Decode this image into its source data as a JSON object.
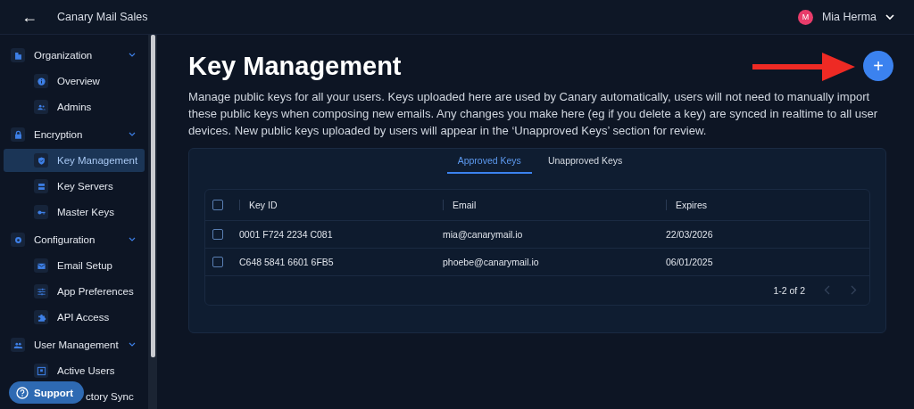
{
  "topbar": {
    "back": "←",
    "title": "Canary Mail Sales",
    "user": {
      "initial": "M",
      "name": "Mia Herma"
    }
  },
  "sidebar": {
    "groups": [
      {
        "label": "Organization",
        "expanded": true,
        "children": [
          {
            "label": "Overview",
            "selected": false
          },
          {
            "label": "Admins",
            "selected": false
          }
        ]
      },
      {
        "label": "Encryption",
        "expanded": true,
        "children": [
          {
            "label": "Key Management",
            "selected": true
          },
          {
            "label": "Key Servers",
            "selected": false
          },
          {
            "label": "Master Keys",
            "selected": false
          }
        ]
      },
      {
        "label": "Configuration",
        "expanded": true,
        "children": [
          {
            "label": "Email Setup",
            "selected": false
          },
          {
            "label": "App Preferences",
            "selected": false
          },
          {
            "label": "API Access",
            "selected": false
          }
        ]
      },
      {
        "label": "User Management",
        "expanded": true,
        "children": [
          {
            "label": "Active Users",
            "selected": false
          },
          {
            "label": "ctory Sync",
            "selected": false,
            "behind_support": true
          }
        ]
      }
    ]
  },
  "support": {
    "label": "Support"
  },
  "page": {
    "title": "Key Management",
    "description": "Manage public keys for all your users. Keys uploaded here are used by Canary automatically, users will not need to manually import these public keys when composing new emails. Any changes you make here (eg if you delete a key) are synced in realtime to all user devices. New public keys uploaded by users will appear in the ‘Unapproved Keys’ section for review.",
    "add_button": "+"
  },
  "tabs": [
    {
      "label": "Approved Keys",
      "selected": true
    },
    {
      "label": "Unapproved Keys",
      "selected": false
    }
  ],
  "table": {
    "select_all": {
      "checked": false
    },
    "columns": [
      "Key ID",
      "Email",
      "Expires"
    ],
    "rows": [
      {
        "checked": false,
        "cells": [
          "0001 F724 2234 C081",
          "mia@canarymail.io",
          "22/03/2026"
        ]
      },
      {
        "checked": false,
        "cells": [
          "C648 5841 6601 6FB5",
          "phoebe@canarymail.io",
          "06/01/2025"
        ]
      }
    ],
    "pagination": {
      "range": "1-2 of 2",
      "prev_disabled": true,
      "next_disabled": true
    }
  }
}
